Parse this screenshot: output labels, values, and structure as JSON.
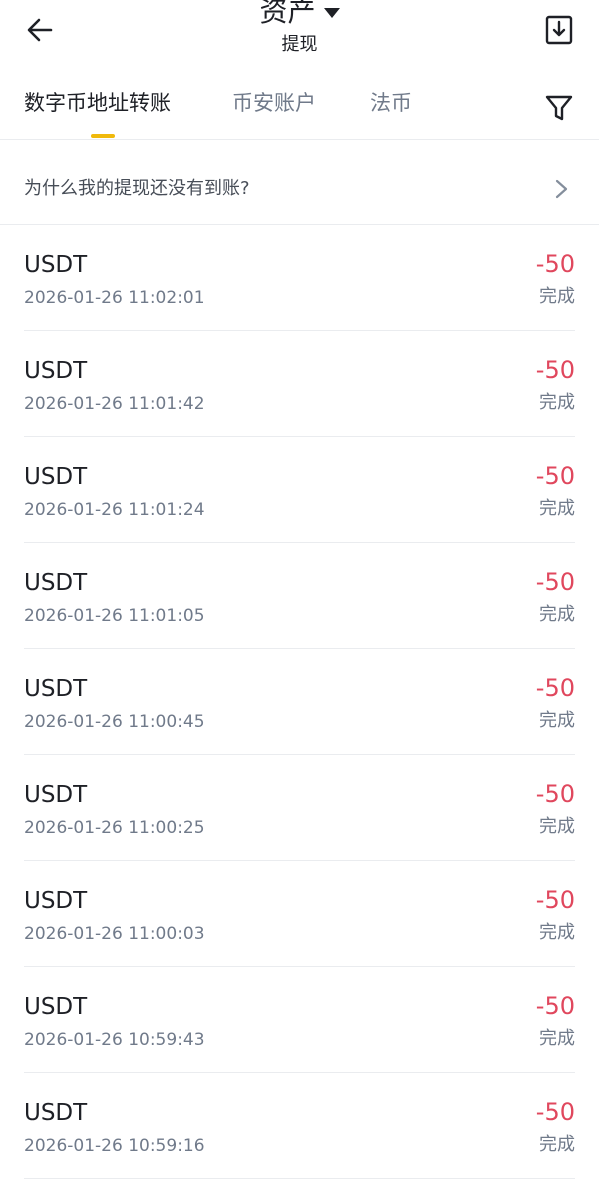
{
  "header": {
    "title": "资产",
    "subtitle": "提现"
  },
  "tabs": [
    {
      "label": "数字币地址转账"
    },
    {
      "label": "币安账户"
    },
    {
      "label": "法币"
    }
  ],
  "faq": {
    "text": "为什么我的提现还没有到账?"
  },
  "records": [
    {
      "coin": "USDT",
      "time": "2026-01-26 11:02:01",
      "amount": "-50",
      "status": "完成"
    },
    {
      "coin": "USDT",
      "time": "2026-01-26 11:01:42",
      "amount": "-50",
      "status": "完成"
    },
    {
      "coin": "USDT",
      "time": "2026-01-26 11:01:24",
      "amount": "-50",
      "status": "完成"
    },
    {
      "coin": "USDT",
      "time": "2026-01-26 11:01:05",
      "amount": "-50",
      "status": "完成"
    },
    {
      "coin": "USDT",
      "time": "2026-01-26 11:00:45",
      "amount": "-50",
      "status": "完成"
    },
    {
      "coin": "USDT",
      "time": "2026-01-26 11:00:25",
      "amount": "-50",
      "status": "完成"
    },
    {
      "coin": "USDT",
      "time": "2026-01-26 11:00:03",
      "amount": "-50",
      "status": "完成"
    },
    {
      "coin": "USDT",
      "time": "2026-01-26 10:59:43",
      "amount": "-50",
      "status": "完成"
    },
    {
      "coin": "USDT",
      "time": "2026-01-26 10:59:16",
      "amount": "-50",
      "status": "完成"
    }
  ],
  "colors": {
    "accent": "#f0b90b",
    "negative": "#e0475d",
    "text_primary": "#1e2026",
    "text_secondary": "#707a8a",
    "divider": "#eaecef"
  },
  "icons": {
    "back": "arrow-left-icon",
    "dropdown": "caret-down-icon",
    "download": "download-icon",
    "filter": "filter-icon",
    "chevron": "chevron-right-icon"
  }
}
